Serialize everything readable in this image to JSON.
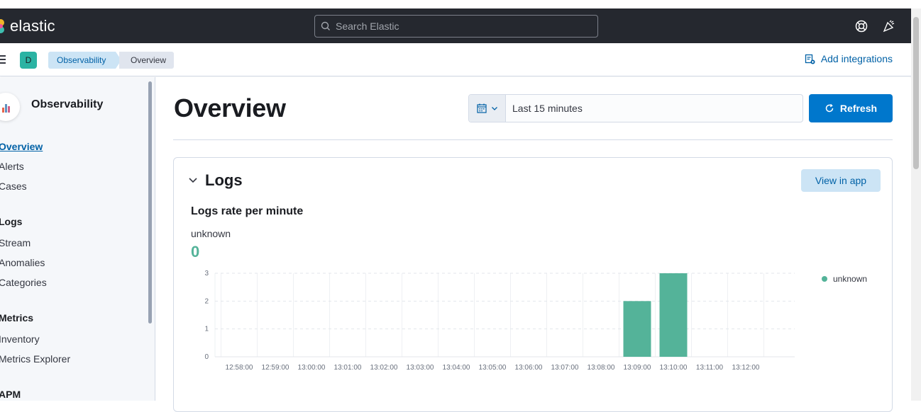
{
  "header": {
    "logo_text": "elastic",
    "search_placeholder": "Search Elastic"
  },
  "subheader": {
    "space_initial": "D",
    "breadcrumbs": [
      "Observability",
      "Overview"
    ],
    "add_integrations": "Add integrations"
  },
  "sidebar": {
    "title": "Observability",
    "items": [
      {
        "label": "Overview",
        "active": true
      },
      {
        "label": "Alerts"
      },
      {
        "label": "Cases"
      }
    ],
    "groups": [
      {
        "title": "Logs",
        "items": [
          "Stream",
          "Anomalies",
          "Categories"
        ]
      },
      {
        "title": "Metrics",
        "items": [
          "Inventory",
          "Metrics Explorer"
        ]
      },
      {
        "title": "APM",
        "items": []
      }
    ]
  },
  "main": {
    "page_title": "Overview",
    "date_range": "Last 15 minutes",
    "refresh_label": "Refresh",
    "panel": {
      "title": "Logs",
      "view_button": "View in app",
      "chart_title": "Logs rate per minute",
      "stat_label": "unknown",
      "stat_value": "0"
    }
  },
  "colors": {
    "accent": "#0077cc",
    "series": "#54b399",
    "topbar": "#25282f"
  },
  "chart_data": {
    "type": "bar",
    "categories": [
      "12:58:00",
      "12:59:00",
      "13:00:00",
      "13:01:00",
      "13:02:00",
      "13:03:00",
      "13:04:00",
      "13:05:00",
      "13:06:00",
      "13:07:00",
      "13:08:00",
      "13:09:00",
      "13:10:00",
      "13:11:00",
      "13:12:00"
    ],
    "series": [
      {
        "name": "unknown",
        "values": [
          0,
          0,
          0,
          0,
          0,
          0,
          0,
          0,
          0,
          0,
          0,
          2,
          3,
          0,
          0
        ]
      }
    ],
    "yticks": [
      "0",
      "1",
      "2",
      "3"
    ],
    "ylim": [
      0,
      3
    ],
    "legend": "right",
    "grid": true
  }
}
